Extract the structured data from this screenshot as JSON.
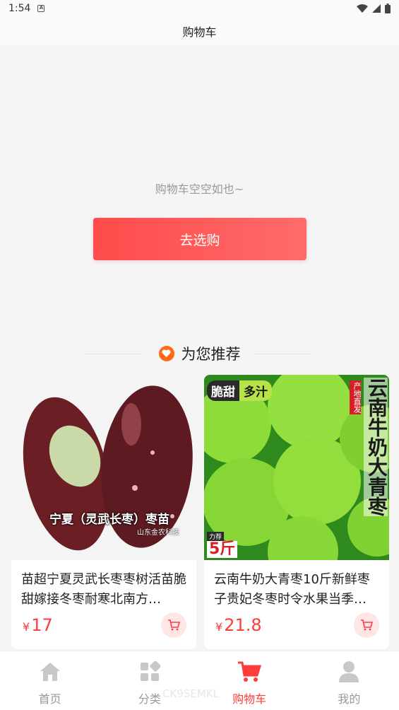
{
  "status_bar": {
    "time": "1:54"
  },
  "header": {
    "title": "购物车"
  },
  "empty_cart": {
    "message": "购物车空空如也~",
    "button_label": "去选购"
  },
  "recommend": {
    "title": "为您推荐"
  },
  "products": [
    {
      "name": "苗超宁夏灵武长枣枣树活苗脆甜嫁接冬枣耐寒北南方…",
      "price_symbol": "¥",
      "price": "17",
      "image_caption": "宁夏（灵武长枣）枣苗",
      "image_subcaption": "山东金农科技"
    },
    {
      "name": "云南牛奶大青枣10斤新鲜枣子贵妃冬枣时令水果当季…",
      "price_symbol": "¥",
      "price": "21.8",
      "badge_left": "脆甜",
      "badge_right": "多汁",
      "vertical_tag": "产地直发",
      "vertical_title": "云南牛奶大青枣",
      "weight_top": "力荐",
      "weight": "5斤"
    }
  ],
  "tab_bar": {
    "items": [
      {
        "label": "首页",
        "icon": "home-icon"
      },
      {
        "label": "分类",
        "icon": "category-icon"
      },
      {
        "label": "购物车",
        "icon": "cart-icon"
      },
      {
        "label": "我的",
        "icon": "user-icon"
      }
    ],
    "active": 2
  },
  "watermark": "CK9SEMKL",
  "colors": {
    "accent": "#ff3b3b",
    "button_gradient_start": "#ff4b4b",
    "button_gradient_end": "#ff6b6b",
    "heart": "#ff6a1a"
  }
}
